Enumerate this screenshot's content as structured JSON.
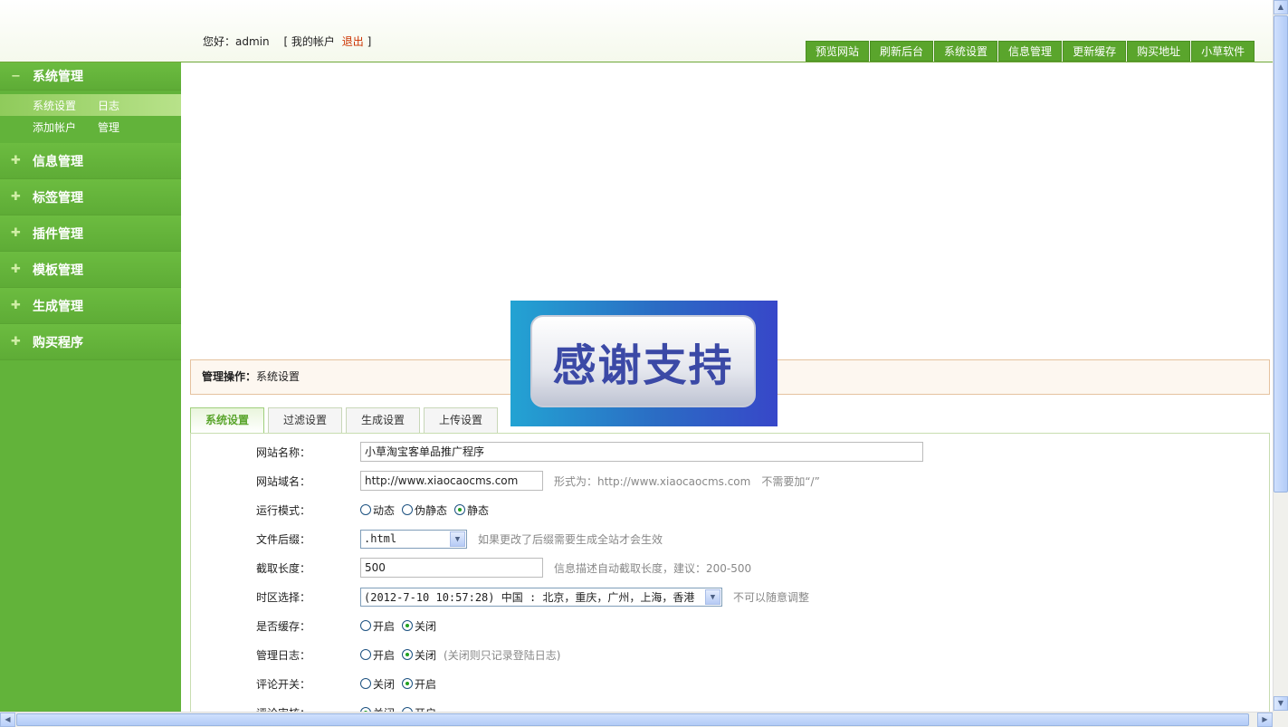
{
  "header": {
    "greeting": "您好：admin",
    "my_account": "[ 我的帐户",
    "logout": "退出",
    "close_bracket": "]",
    "nav": [
      "预览网站",
      "刷新后台",
      "系统设置",
      "信息管理",
      "更新缓存",
      "购买地址",
      "小草软件"
    ]
  },
  "sidebar": {
    "groups": [
      {
        "label": "系统管理",
        "icon": "minus-icon",
        "open": true
      },
      {
        "label": "信息管理",
        "icon": "plus-icon"
      },
      {
        "label": "标签管理",
        "icon": "plus-icon"
      },
      {
        "label": "插件管理",
        "icon": "plus-icon"
      },
      {
        "label": "模板管理",
        "icon": "plus-icon"
      },
      {
        "label": "生成管理",
        "icon": "plus-icon"
      },
      {
        "label": "购买程序",
        "icon": "plus-icon"
      }
    ],
    "subitems": [
      {
        "a": "系统设置",
        "b": "日志"
      },
      {
        "a": "添加帐户",
        "b": "管理"
      }
    ]
  },
  "breadcrumb": {
    "label": "管理操作：",
    "value": "系统设置"
  },
  "tabs": [
    "系统设置",
    "过滤设置",
    "生成设置",
    "上传设置"
  ],
  "banner": {
    "text": "感谢支持"
  },
  "form": {
    "site_name": {
      "label": "网站名称：",
      "value": "小草淘宝客单品推广程序"
    },
    "site_domain": {
      "label": "网站域名：",
      "value": "http://www.xiaocaocms.com",
      "hint1": "形式为：http://www.xiaocaocms.com",
      "hint2": "不需要加“/”"
    },
    "run_mode": {
      "label": "运行模式：",
      "options": [
        "动态",
        "伪静态",
        "静态"
      ],
      "selected": 2
    },
    "file_suffix": {
      "label": "文件后缀：",
      "value": ".html",
      "hint": "如果更改了后缀需要生成全站才会生效"
    },
    "cut_length": {
      "label": "截取长度：",
      "value": "500",
      "hint": "信息描述自动截取长度，建议：200-500"
    },
    "timezone": {
      "label": "时区选择：",
      "value": "(2012-7-10 10:57:28) 中国 : 北京，重庆，广州，上海，香港",
      "hint": "不可以随意调整"
    },
    "cache": {
      "label": "是否缓存：",
      "options": [
        "开启",
        "关闭"
      ],
      "selected": 1
    },
    "admin_log": {
      "label": "管理日志：",
      "options": [
        "开启",
        "关闭"
      ],
      "selected": 1,
      "hint": "(关闭则只记录登陆日志)"
    },
    "comment": {
      "label": "评论开关：",
      "options": [
        "关闭",
        "开启"
      ],
      "selected": 1
    },
    "comment_review": {
      "label": "评论审核：",
      "options": [
        "关闭",
        "开启"
      ],
      "selected": 0
    }
  },
  "colors": {
    "sidebar": "#62b33a",
    "nav": "#5aa52c",
    "logout": "#cc3300"
  }
}
